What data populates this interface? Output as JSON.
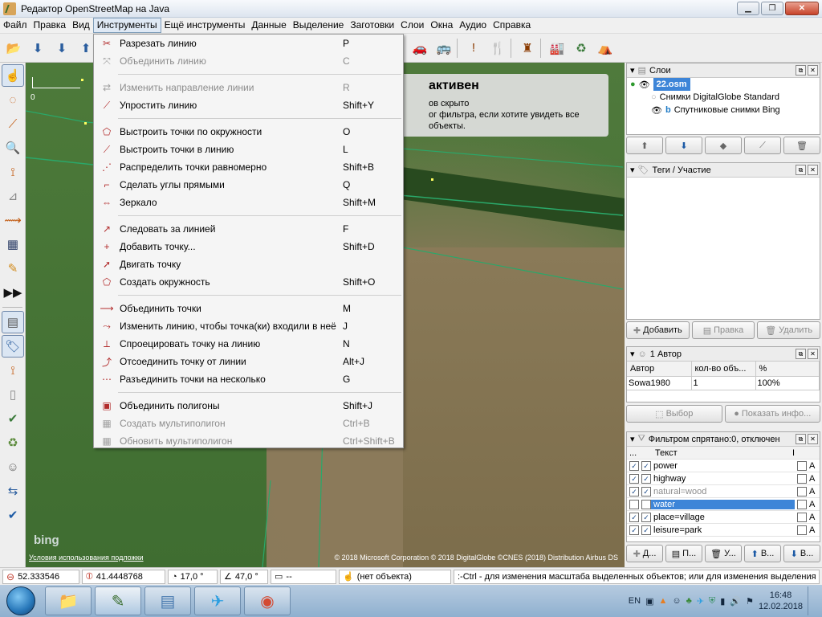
{
  "window": {
    "title": "Редактор OpenStreetMap на Java",
    "minimize": "▁",
    "maximize": "❐",
    "close": "✕"
  },
  "menubar": [
    "Файл",
    "Правка",
    "Вид",
    "Инструменты",
    "Ещё инструменты",
    "Данные",
    "Выделение",
    "Заготовки",
    "Слои",
    "Окна",
    "Аудио",
    "Справка"
  ],
  "map": {
    "scale_label": "0",
    "notice_title": "активен",
    "notice_line1": "ов скрыто",
    "notice_line2": "ог фильтра, если хотите увидеть все объекты.",
    "bing_logo": "bing",
    "attribution_left": "Условия использования подложки",
    "attribution_right": "© 2018 Microsoft Corporation © 2018 DigitalGlobe ©CNES (2018) Distribution Airbus DS"
  },
  "tools_menu": {
    "groups": [
      [
        {
          "label": "Разрезать линию",
          "shortcut": "P",
          "icon": "✂",
          "enabled": true
        },
        {
          "label": "Объединить линию",
          "shortcut": "C",
          "icon": "⤧",
          "enabled": false
        }
      ],
      [
        {
          "label": "Изменить направление линии",
          "shortcut": "R",
          "icon": "⇄",
          "enabled": false
        },
        {
          "label": "Упростить линию",
          "shortcut": "Shift+Y",
          "icon": "⟋",
          "enabled": true
        }
      ],
      [
        {
          "label": "Выстроить точки по окружности",
          "shortcut": "O",
          "icon": "⬠",
          "enabled": true
        },
        {
          "label": "Выстроить точки в линию",
          "shortcut": "L",
          "icon": "⟋",
          "enabled": true
        },
        {
          "label": "Распределить точки равномерно",
          "shortcut": "Shift+B",
          "icon": "⋰",
          "enabled": true
        },
        {
          "label": "Сделать углы прямыми",
          "shortcut": "Q",
          "icon": "⌐",
          "enabled": true
        },
        {
          "label": "Зеркало",
          "shortcut": "Shift+M",
          "icon": "⇔",
          "enabled": true
        }
      ],
      [
        {
          "label": "Следовать за линией",
          "shortcut": "F",
          "icon": "↗",
          "enabled": true
        },
        {
          "label": "Добавить точку...",
          "shortcut": "Shift+D",
          "icon": "+",
          "enabled": true
        },
        {
          "label": "Двигать точку",
          "shortcut": "",
          "icon": "➚",
          "enabled": true
        },
        {
          "label": "Создать окружность",
          "shortcut": "Shift+O",
          "icon": "⬠",
          "enabled": true
        }
      ],
      [
        {
          "label": "Объединить точки",
          "shortcut": "M",
          "icon": "⟶",
          "enabled": true
        },
        {
          "label": "Изменить линию, чтобы точка(ки) входили в неё",
          "shortcut": "J",
          "icon": "⤳",
          "enabled": true
        },
        {
          "label": "Спроецировать точку на линию",
          "shortcut": "N",
          "icon": "⟂",
          "enabled": true
        },
        {
          "label": "Отсоединить точку от линии",
          "shortcut": "Alt+J",
          "icon": "⤴",
          "enabled": true
        },
        {
          "label": "Разъединить точки на несколько",
          "shortcut": "G",
          "icon": "⋯",
          "enabled": true
        }
      ],
      [
        {
          "label": "Объединить полигоны",
          "shortcut": "Shift+J",
          "icon": "▣",
          "enabled": true
        },
        {
          "label": "Создать мультиполигон",
          "shortcut": "Ctrl+B",
          "icon": "▦",
          "enabled": false
        },
        {
          "label": "Обновить мультиполигон",
          "shortcut": "Ctrl+Shift+B",
          "icon": "▦",
          "enabled": false
        }
      ]
    ]
  },
  "layers_panel": {
    "title": "Слои",
    "layers": [
      {
        "name": "22.osm",
        "selected": true
      },
      {
        "name": "Снимки DigitalGlobe Standard",
        "selected": false
      },
      {
        "name": "Спутниковые снимки Bing",
        "selected": false
      }
    ]
  },
  "tags_panel": {
    "title": "Теги / Участие",
    "add": "Добавить",
    "edit": "Правка",
    "delete": "Удалить"
  },
  "authors_panel": {
    "title": "1 Автор",
    "columns": [
      "Автор",
      "кол-во объ...",
      "%"
    ],
    "rows": [
      [
        "Sowa1980",
        "1",
        "100%"
      ]
    ],
    "select_btn": "Выбор",
    "info_btn": "Показать инфо..."
  },
  "filter_panel": {
    "title": "Фильтром спрятано:0, отключен",
    "col_text": "Текст",
    "col_i": "I",
    "dots": "...",
    "rows": [
      {
        "text": "power",
        "state": "normal",
        "check": "✓"
      },
      {
        "text": "highway",
        "state": "normal",
        "check": "✓"
      },
      {
        "text": "natural=wood",
        "state": "dim",
        "check": "✓"
      },
      {
        "text": "water",
        "state": "sel",
        "check": ""
      },
      {
        "text": "place=village",
        "state": "normal",
        "check": "✓"
      },
      {
        "text": "leisure=park",
        "state": "normal",
        "check": "✓"
      }
    ],
    "flag": "A",
    "btns": [
      "Д...",
      "П...",
      "У...",
      "В...",
      "В..."
    ]
  },
  "statusbar": {
    "lat": "52.333546",
    "lon": "41.4448768",
    "heading": "17,0 °",
    "angle": "47,0 °",
    "length": "--",
    "object": "(нет объекта)",
    "hint": ":-Ctrl - для изменения масштаба выделенных объектов; или для изменения выделения"
  },
  "taskbar": {
    "lang": "EN",
    "time": "16:48",
    "date": "12.02.2018"
  }
}
